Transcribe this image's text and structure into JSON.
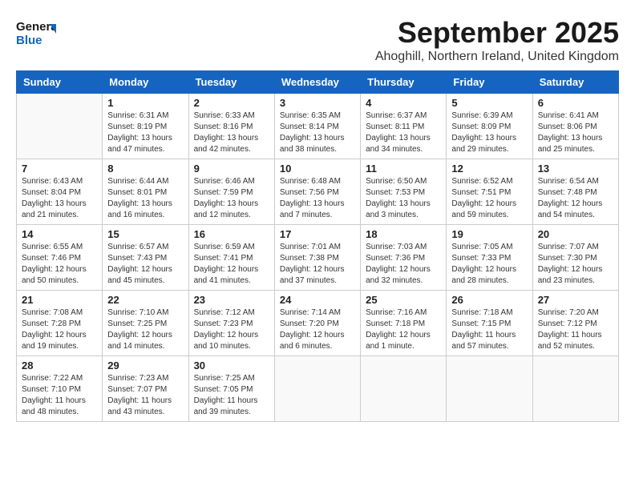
{
  "header": {
    "logo_general": "General",
    "logo_blue": "Blue",
    "month_title": "September 2025",
    "subtitle": "Ahoghill, Northern Ireland, United Kingdom"
  },
  "weekdays": [
    "Sunday",
    "Monday",
    "Tuesday",
    "Wednesday",
    "Thursday",
    "Friday",
    "Saturday"
  ],
  "weeks": [
    [
      {
        "day": null,
        "info": null
      },
      {
        "day": "1",
        "info": "Sunrise: 6:31 AM\nSunset: 8:19 PM\nDaylight: 13 hours\nand 47 minutes."
      },
      {
        "day": "2",
        "info": "Sunrise: 6:33 AM\nSunset: 8:16 PM\nDaylight: 13 hours\nand 42 minutes."
      },
      {
        "day": "3",
        "info": "Sunrise: 6:35 AM\nSunset: 8:14 PM\nDaylight: 13 hours\nand 38 minutes."
      },
      {
        "day": "4",
        "info": "Sunrise: 6:37 AM\nSunset: 8:11 PM\nDaylight: 13 hours\nand 34 minutes."
      },
      {
        "day": "5",
        "info": "Sunrise: 6:39 AM\nSunset: 8:09 PM\nDaylight: 13 hours\nand 29 minutes."
      },
      {
        "day": "6",
        "info": "Sunrise: 6:41 AM\nSunset: 8:06 PM\nDaylight: 13 hours\nand 25 minutes."
      }
    ],
    [
      {
        "day": "7",
        "info": "Sunrise: 6:43 AM\nSunset: 8:04 PM\nDaylight: 13 hours\nand 21 minutes."
      },
      {
        "day": "8",
        "info": "Sunrise: 6:44 AM\nSunset: 8:01 PM\nDaylight: 13 hours\nand 16 minutes."
      },
      {
        "day": "9",
        "info": "Sunrise: 6:46 AM\nSunset: 7:59 PM\nDaylight: 13 hours\nand 12 minutes."
      },
      {
        "day": "10",
        "info": "Sunrise: 6:48 AM\nSunset: 7:56 PM\nDaylight: 13 hours\nand 7 minutes."
      },
      {
        "day": "11",
        "info": "Sunrise: 6:50 AM\nSunset: 7:53 PM\nDaylight: 13 hours\nand 3 minutes."
      },
      {
        "day": "12",
        "info": "Sunrise: 6:52 AM\nSunset: 7:51 PM\nDaylight: 12 hours\nand 59 minutes."
      },
      {
        "day": "13",
        "info": "Sunrise: 6:54 AM\nSunset: 7:48 PM\nDaylight: 12 hours\nand 54 minutes."
      }
    ],
    [
      {
        "day": "14",
        "info": "Sunrise: 6:55 AM\nSunset: 7:46 PM\nDaylight: 12 hours\nand 50 minutes."
      },
      {
        "day": "15",
        "info": "Sunrise: 6:57 AM\nSunset: 7:43 PM\nDaylight: 12 hours\nand 45 minutes."
      },
      {
        "day": "16",
        "info": "Sunrise: 6:59 AM\nSunset: 7:41 PM\nDaylight: 12 hours\nand 41 minutes."
      },
      {
        "day": "17",
        "info": "Sunrise: 7:01 AM\nSunset: 7:38 PM\nDaylight: 12 hours\nand 37 minutes."
      },
      {
        "day": "18",
        "info": "Sunrise: 7:03 AM\nSunset: 7:36 PM\nDaylight: 12 hours\nand 32 minutes."
      },
      {
        "day": "19",
        "info": "Sunrise: 7:05 AM\nSunset: 7:33 PM\nDaylight: 12 hours\nand 28 minutes."
      },
      {
        "day": "20",
        "info": "Sunrise: 7:07 AM\nSunset: 7:30 PM\nDaylight: 12 hours\nand 23 minutes."
      }
    ],
    [
      {
        "day": "21",
        "info": "Sunrise: 7:08 AM\nSunset: 7:28 PM\nDaylight: 12 hours\nand 19 minutes."
      },
      {
        "day": "22",
        "info": "Sunrise: 7:10 AM\nSunset: 7:25 PM\nDaylight: 12 hours\nand 14 minutes."
      },
      {
        "day": "23",
        "info": "Sunrise: 7:12 AM\nSunset: 7:23 PM\nDaylight: 12 hours\nand 10 minutes."
      },
      {
        "day": "24",
        "info": "Sunrise: 7:14 AM\nSunset: 7:20 PM\nDaylight: 12 hours\nand 6 minutes."
      },
      {
        "day": "25",
        "info": "Sunrise: 7:16 AM\nSunset: 7:18 PM\nDaylight: 12 hours\nand 1 minute."
      },
      {
        "day": "26",
        "info": "Sunrise: 7:18 AM\nSunset: 7:15 PM\nDaylight: 11 hours\nand 57 minutes."
      },
      {
        "day": "27",
        "info": "Sunrise: 7:20 AM\nSunset: 7:12 PM\nDaylight: 11 hours\nand 52 minutes."
      }
    ],
    [
      {
        "day": "28",
        "info": "Sunrise: 7:22 AM\nSunset: 7:10 PM\nDaylight: 11 hours\nand 48 minutes."
      },
      {
        "day": "29",
        "info": "Sunrise: 7:23 AM\nSunset: 7:07 PM\nDaylight: 11 hours\nand 43 minutes."
      },
      {
        "day": "30",
        "info": "Sunrise: 7:25 AM\nSunset: 7:05 PM\nDaylight: 11 hours\nand 39 minutes."
      },
      {
        "day": null,
        "info": null
      },
      {
        "day": null,
        "info": null
      },
      {
        "day": null,
        "info": null
      },
      {
        "day": null,
        "info": null
      }
    ]
  ]
}
